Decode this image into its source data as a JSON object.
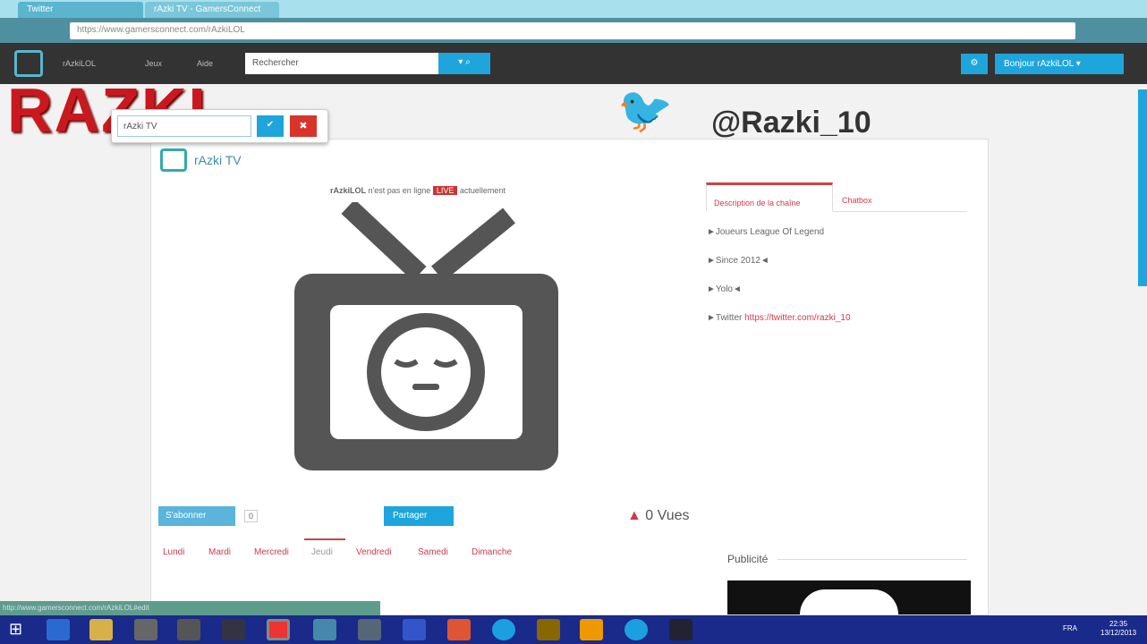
{
  "browser": {
    "tabs": [
      "Twitter",
      "rAzki TV - GamersConnect"
    ],
    "url": "https://www.gamersconnect.com/rAzkiLOL"
  },
  "nav": {
    "links": [
      "rAzkiLOL",
      "Jeux",
      "Aide"
    ],
    "search_placeholder": "Rechercher",
    "user_button": "Bonjour rAzkiLOL"
  },
  "banner": {
    "logo_text": "RAZKI",
    "twitter_handle": "@Razki_10"
  },
  "popup": {
    "input_value": "rAzki TV"
  },
  "channel": {
    "title": "rAzki TV",
    "status_user": "rAzkiLOL",
    "status_text": "n'est pas en ligne",
    "status_badge": "LIVE",
    "status_suffix": "actuellement",
    "subscribe": "S'abonner",
    "subscribe_count": "0",
    "share": "Partager",
    "views": "0 Vues"
  },
  "side_tabs": [
    "Description de la chaîne",
    "Chatbox"
  ],
  "description": [
    "►Joueurs League Of Legend",
    "►Since 2012◄",
    "►Yolo◄",
    "►Twitter "
  ],
  "twitter_link": "https://twitter.com/razki_10",
  "days": [
    "Lundi",
    "Mardi",
    "Mercredi",
    "Jeudi",
    "Vendredi",
    "Samedi",
    "Dimanche"
  ],
  "active_day": "Jeudi",
  "ads_title": "Publicité",
  "status_bar": "http://www.gamersconnect.com/rAzkiLOL#edit",
  "clock": {
    "time": "22:35",
    "date": "13/12/2013"
  },
  "lang": "FRA"
}
